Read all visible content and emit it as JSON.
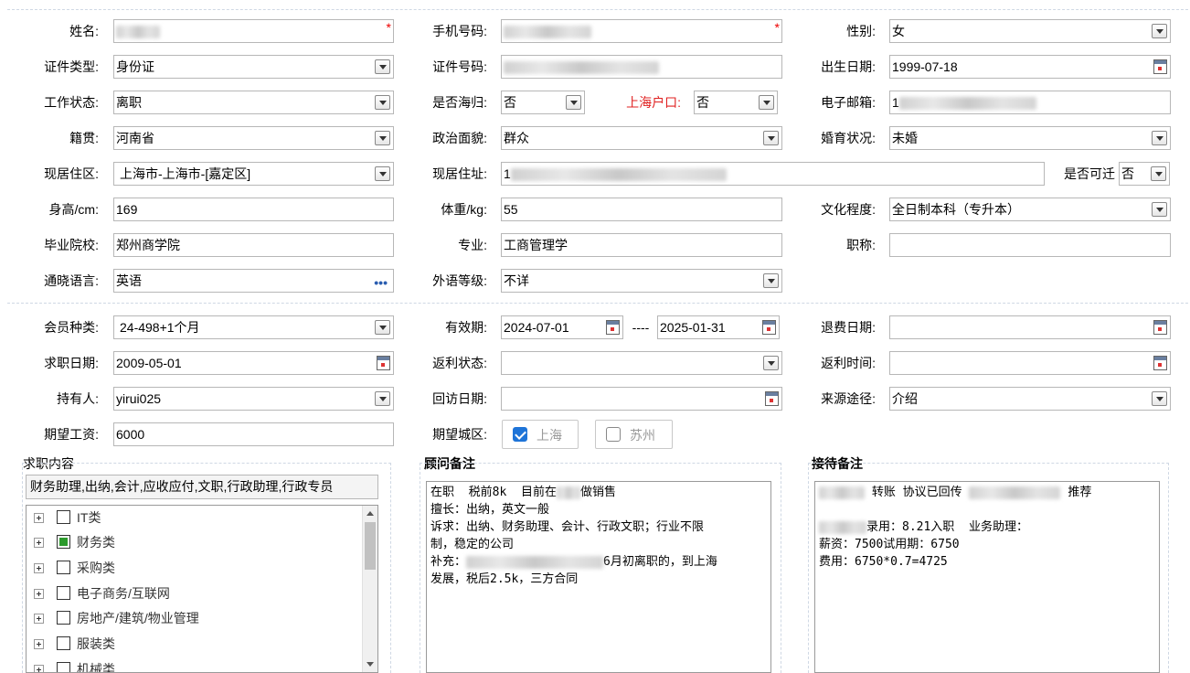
{
  "form": {
    "name": {
      "label": "姓名:",
      "required": "*"
    },
    "mobile": {
      "label": "手机号码:",
      "required": "*"
    },
    "gender": {
      "label": "性别:",
      "value": "女"
    },
    "id_type": {
      "label": "证件类型:",
      "value": "身份证"
    },
    "id_number": {
      "label": "证件号码:"
    },
    "birth_date": {
      "label": "出生日期:",
      "value": "1999-07-18"
    },
    "work_status": {
      "label": "工作状态:",
      "value": "离职"
    },
    "returnee": {
      "label": "是否海归:",
      "value": "否"
    },
    "shanghai_hukou": {
      "label": "上海户口:",
      "value": "否"
    },
    "email": {
      "label": "电子邮箱:",
      "value_prefix": "1"
    },
    "native_place": {
      "label": "籍贯:",
      "value": "河南省"
    },
    "political_status": {
      "label": "政治面貌:",
      "value": "群众"
    },
    "marital_status": {
      "label": "婚育状况:",
      "value": "未婚"
    },
    "residence_area": {
      "label": "现居住区:",
      "value": "上海市-上海市-[嘉定区]"
    },
    "residence_address": {
      "label": "现居住址:",
      "value_prefix": "1"
    },
    "relocatable": {
      "label": "是否可迁",
      "value": "否"
    },
    "height": {
      "label": "身高/cm:",
      "value": "169"
    },
    "weight": {
      "label": "体重/kg:",
      "value": "55"
    },
    "education": {
      "label": "文化程度:",
      "value": "全日制本科（专升本）"
    },
    "school": {
      "label": "毕业院校:",
      "value": "郑州商学院"
    },
    "major": {
      "label": "专业:",
      "value": "工商管理学"
    },
    "title": {
      "label": "职称:",
      "value": ""
    },
    "languages": {
      "label": "通晓语言:",
      "value": "英语"
    },
    "language_level": {
      "label": "外语等级:",
      "value": "不详"
    }
  },
  "membership": {
    "member_type": {
      "label": "会员种类:",
      "value": "24-498+1个月"
    },
    "validity": {
      "label": "有效期:",
      "start": "2024-07-01",
      "separator": "----",
      "end": "2025-01-31"
    },
    "refund_date": {
      "label": "退费日期:",
      "value": ""
    },
    "job_seek_date": {
      "label": "求职日期:",
      "value": "2009-05-01"
    },
    "rebate_status": {
      "label": "返利状态:",
      "value": ""
    },
    "rebate_time": {
      "label": "返利时间:",
      "value": ""
    },
    "holder": {
      "label": "持有人:",
      "value": "yirui025"
    },
    "visit_date": {
      "label": "回访日期:",
      "value": ""
    },
    "source": {
      "label": "来源途径:",
      "value": "介绍"
    },
    "expected_salary": {
      "label": "期望工资:",
      "value": "6000"
    },
    "expected_city": {
      "label": "期望城区:",
      "options": [
        {
          "label": "上海",
          "checked": true
        },
        {
          "label": "苏州",
          "checked": false
        }
      ]
    }
  },
  "job_content": {
    "title": "求职内容",
    "summary": "财务助理,出纳,会计,应收应付,文职,行政助理,行政专员",
    "tree": [
      {
        "label": "IT类",
        "checked": false
      },
      {
        "label": "财务类",
        "checked": true
      },
      {
        "label": "采购类",
        "checked": false
      },
      {
        "label": "电子商务/互联网",
        "checked": false
      },
      {
        "label": "房地产/建筑/物业管理",
        "checked": false
      },
      {
        "label": "服装类",
        "checked": false
      },
      {
        "label": "机械类",
        "checked": false
      }
    ]
  },
  "advisor_notes": {
    "title": "顾问备注",
    "l1a": "在职  税前8k  目前在",
    "l1b": "做销售",
    "l2": "擅长：出纳，英文一般",
    "l3": "诉求：出纳、财务助理、会计、行政文职；行业不限",
    "l4": "制，稳定的公司",
    "l5a": "补充：",
    "l5b": "6月初离职的，到上海",
    "l6": "发展，税后2.5k，三方合同"
  },
  "reception_notes": {
    "title": "接待备注",
    "l1a": "转账 协议已回传",
    "l1b": "推荐",
    "l3b": "录用：8.21入职  业务助理：",
    "l4": "薪资：7500试用期：6750",
    "l5": "费用：6750*0.7=4725"
  }
}
